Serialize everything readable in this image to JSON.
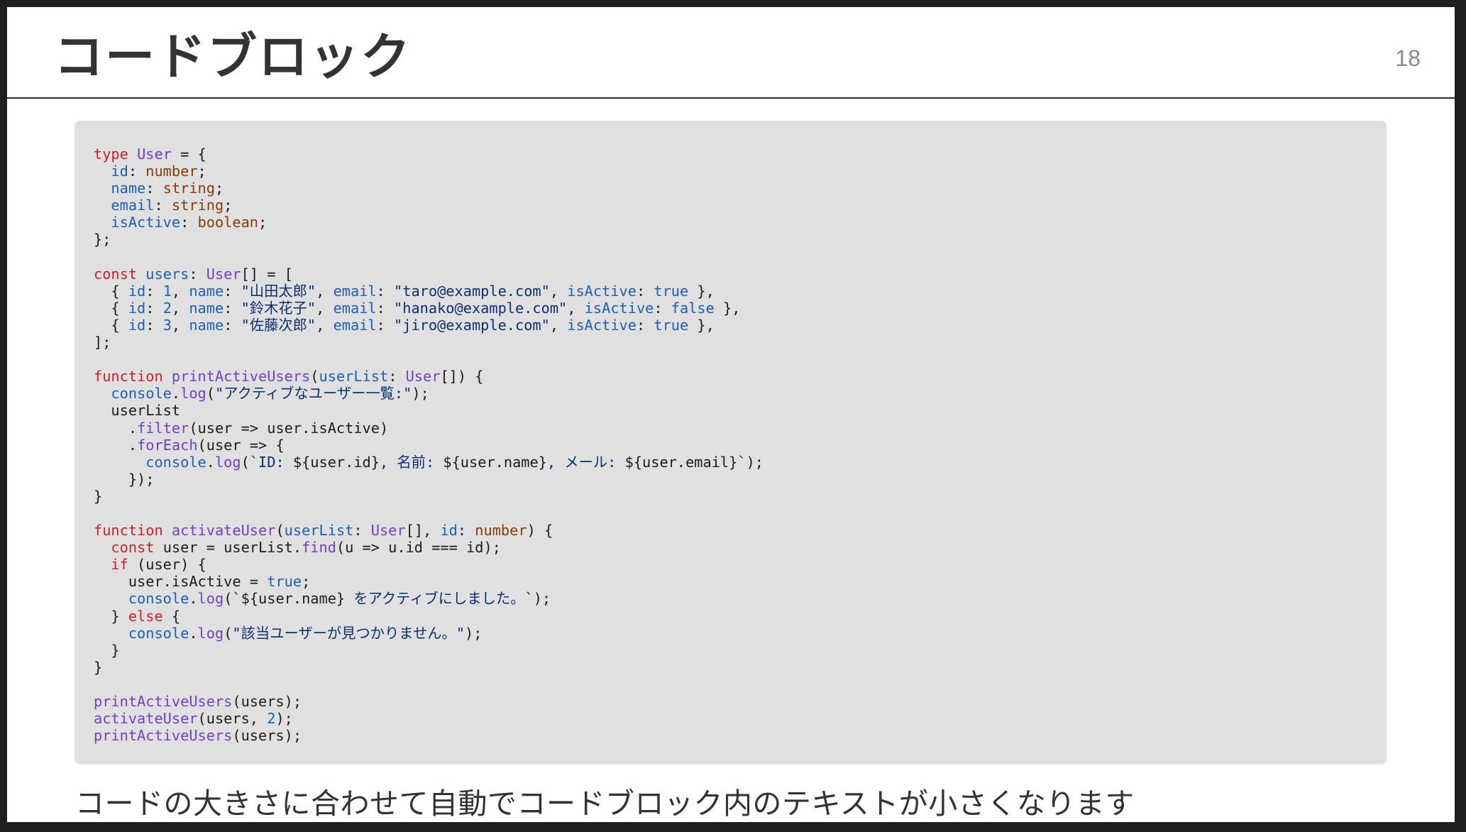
{
  "slide": {
    "title": "コードブロック",
    "page_number": "18",
    "caption": "コードの大きさに合わせて自動でコードブロック内のテキストが小さくなります",
    "code_lines": [
      [
        {
          "t": "type",
          "c": "kw"
        },
        {
          "t": " "
        },
        {
          "t": "User",
          "c": "ty"
        },
        {
          "t": " = {"
        }
      ],
      [
        {
          "t": "  "
        },
        {
          "t": "id",
          "c": "prop"
        },
        {
          "t": ": "
        },
        {
          "t": "number",
          "c": "prim"
        },
        {
          "t": ";"
        }
      ],
      [
        {
          "t": "  "
        },
        {
          "t": "name",
          "c": "prop"
        },
        {
          "t": ": "
        },
        {
          "t": "string",
          "c": "prim"
        },
        {
          "t": ";"
        }
      ],
      [
        {
          "t": "  "
        },
        {
          "t": "email",
          "c": "prop"
        },
        {
          "t": ": "
        },
        {
          "t": "string",
          "c": "prim"
        },
        {
          "t": ";"
        }
      ],
      [
        {
          "t": "  "
        },
        {
          "t": "isActive",
          "c": "prop"
        },
        {
          "t": ": "
        },
        {
          "t": "boolean",
          "c": "prim"
        },
        {
          "t": ";"
        }
      ],
      [
        {
          "t": "};"
        }
      ],
      [],
      [
        {
          "t": "const",
          "c": "kw"
        },
        {
          "t": " "
        },
        {
          "t": "users",
          "c": "prop"
        },
        {
          "t": ": "
        },
        {
          "t": "User",
          "c": "ty"
        },
        {
          "t": "[] = ["
        }
      ],
      [
        {
          "t": "  { "
        },
        {
          "t": "id",
          "c": "prop"
        },
        {
          "t": ": "
        },
        {
          "t": "1",
          "c": "num"
        },
        {
          "t": ", "
        },
        {
          "t": "name",
          "c": "prop"
        },
        {
          "t": ": "
        },
        {
          "t": "\"山田太郎\"",
          "c": "str"
        },
        {
          "t": ", "
        },
        {
          "t": "email",
          "c": "prop"
        },
        {
          "t": ": "
        },
        {
          "t": "\"taro@example.com\"",
          "c": "str"
        },
        {
          "t": ", "
        },
        {
          "t": "isActive",
          "c": "prop"
        },
        {
          "t": ": "
        },
        {
          "t": "true",
          "c": "num"
        },
        {
          "t": " },"
        }
      ],
      [
        {
          "t": "  { "
        },
        {
          "t": "id",
          "c": "prop"
        },
        {
          "t": ": "
        },
        {
          "t": "2",
          "c": "num"
        },
        {
          "t": ", "
        },
        {
          "t": "name",
          "c": "prop"
        },
        {
          "t": ": "
        },
        {
          "t": "\"鈴木花子\"",
          "c": "str"
        },
        {
          "t": ", "
        },
        {
          "t": "email",
          "c": "prop"
        },
        {
          "t": ": "
        },
        {
          "t": "\"hanako@example.com\"",
          "c": "str"
        },
        {
          "t": ", "
        },
        {
          "t": "isActive",
          "c": "prop"
        },
        {
          "t": ": "
        },
        {
          "t": "false",
          "c": "num"
        },
        {
          "t": " },"
        }
      ],
      [
        {
          "t": "  { "
        },
        {
          "t": "id",
          "c": "prop"
        },
        {
          "t": ": "
        },
        {
          "t": "3",
          "c": "num"
        },
        {
          "t": ", "
        },
        {
          "t": "name",
          "c": "prop"
        },
        {
          "t": ": "
        },
        {
          "t": "\"佐藤次郎\"",
          "c": "str"
        },
        {
          "t": ", "
        },
        {
          "t": "email",
          "c": "prop"
        },
        {
          "t": ": "
        },
        {
          "t": "\"jiro@example.com\"",
          "c": "str"
        },
        {
          "t": ", "
        },
        {
          "t": "isActive",
          "c": "prop"
        },
        {
          "t": ": "
        },
        {
          "t": "true",
          "c": "num"
        },
        {
          "t": " },"
        }
      ],
      [
        {
          "t": "];"
        }
      ],
      [],
      [
        {
          "t": "function",
          "c": "kw"
        },
        {
          "t": " "
        },
        {
          "t": "printActiveUsers",
          "c": "fn"
        },
        {
          "t": "("
        },
        {
          "t": "userList",
          "c": "prop"
        },
        {
          "t": ": "
        },
        {
          "t": "User",
          "c": "ty"
        },
        {
          "t": "[]) {"
        }
      ],
      [
        {
          "t": "  "
        },
        {
          "t": "console",
          "c": "prop"
        },
        {
          "t": "."
        },
        {
          "t": "log",
          "c": "fn"
        },
        {
          "t": "("
        },
        {
          "t": "\"アクティブなユーザー一覧:\"",
          "c": "str"
        },
        {
          "t": ");"
        }
      ],
      [
        {
          "t": "  userList"
        }
      ],
      [
        {
          "t": "    ."
        },
        {
          "t": "filter",
          "c": "fn"
        },
        {
          "t": "(user => user.isActive)"
        }
      ],
      [
        {
          "t": "    ."
        },
        {
          "t": "forEach",
          "c": "fn"
        },
        {
          "t": "(user => {"
        }
      ],
      [
        {
          "t": "      "
        },
        {
          "t": "console",
          "c": "prop"
        },
        {
          "t": "."
        },
        {
          "t": "log",
          "c": "fn"
        },
        {
          "t": "(`"
        },
        {
          "t": "ID: ",
          "c": "str"
        },
        {
          "t": "${user.id}"
        },
        {
          "t": ", 名前: ",
          "c": "str"
        },
        {
          "t": "${user.name}"
        },
        {
          "t": ", メール: ",
          "c": "str"
        },
        {
          "t": "${user.email}"
        },
        {
          "t": "`);"
        }
      ],
      [
        {
          "t": "    });"
        }
      ],
      [
        {
          "t": "}"
        }
      ],
      [],
      [
        {
          "t": "function",
          "c": "kw"
        },
        {
          "t": " "
        },
        {
          "t": "activateUser",
          "c": "fn"
        },
        {
          "t": "("
        },
        {
          "t": "userList",
          "c": "prop"
        },
        {
          "t": ": "
        },
        {
          "t": "User",
          "c": "ty"
        },
        {
          "t": "[], "
        },
        {
          "t": "id",
          "c": "prop"
        },
        {
          "t": ": "
        },
        {
          "t": "number",
          "c": "prim"
        },
        {
          "t": ") {"
        }
      ],
      [
        {
          "t": "  "
        },
        {
          "t": "const",
          "c": "kw"
        },
        {
          "t": " user = userList."
        },
        {
          "t": "find",
          "c": "fn"
        },
        {
          "t": "(u => u.id === id);"
        }
      ],
      [
        {
          "t": "  "
        },
        {
          "t": "if",
          "c": "kw"
        },
        {
          "t": " (user) {"
        }
      ],
      [
        {
          "t": "    user.isActive = "
        },
        {
          "t": "true",
          "c": "num"
        },
        {
          "t": ";"
        }
      ],
      [
        {
          "t": "    "
        },
        {
          "t": "console",
          "c": "prop"
        },
        {
          "t": "."
        },
        {
          "t": "log",
          "c": "fn"
        },
        {
          "t": "(`${user.name}"
        },
        {
          "t": " をアクティブにしました。",
          "c": "str"
        },
        {
          "t": "`);"
        }
      ],
      [
        {
          "t": "  } "
        },
        {
          "t": "else",
          "c": "kw"
        },
        {
          "t": " {"
        }
      ],
      [
        {
          "t": "    "
        },
        {
          "t": "console",
          "c": "prop"
        },
        {
          "t": "."
        },
        {
          "t": "log",
          "c": "fn"
        },
        {
          "t": "("
        },
        {
          "t": "\"該当ユーザーが見つかりません。\"",
          "c": "str"
        },
        {
          "t": ");"
        }
      ],
      [
        {
          "t": "  }"
        }
      ],
      [
        {
          "t": "}"
        }
      ],
      [],
      [
        {
          "t": "printActiveUsers",
          "c": "fn"
        },
        {
          "t": "(users);"
        }
      ],
      [
        {
          "t": "activateUser",
          "c": "fn"
        },
        {
          "t": "(users, "
        },
        {
          "t": "2",
          "c": "num"
        },
        {
          "t": ");"
        }
      ],
      [
        {
          "t": "printActiveUsers",
          "c": "fn"
        },
        {
          "t": "(users);"
        }
      ]
    ]
  },
  "colors": {
    "keyword": "#c8232c",
    "type": "#6f42c1",
    "property": "#1d5fb2",
    "primitive": "#8a3b06",
    "string": "#0d2f6e",
    "code_background": "#e0e0e0",
    "frame": "#1f1f1f"
  }
}
